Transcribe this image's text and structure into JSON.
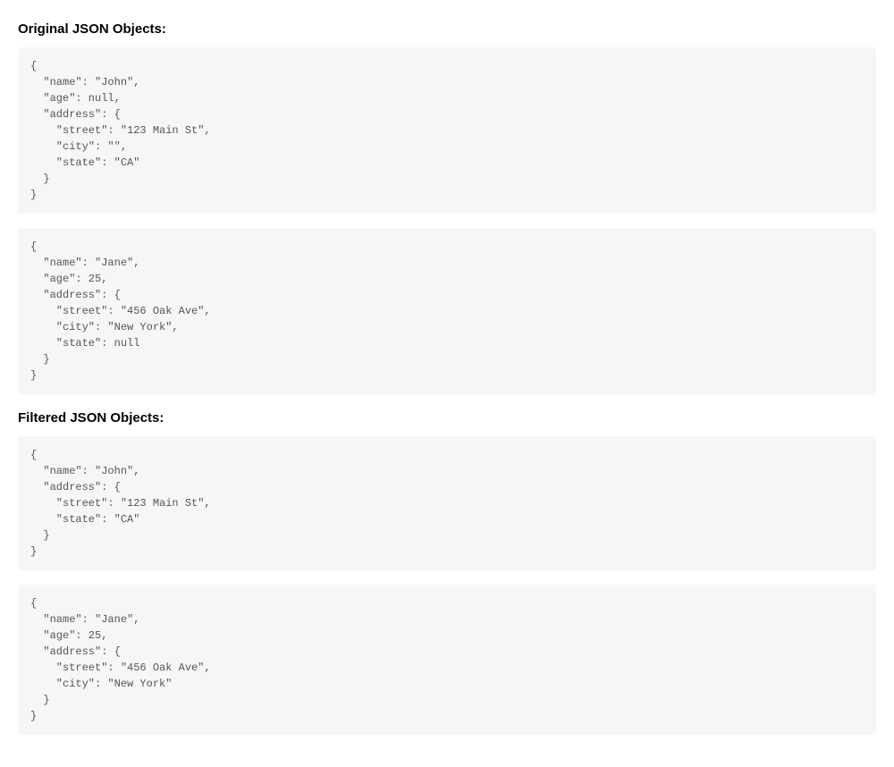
{
  "headings": {
    "original": "Original JSON Objects:",
    "filtered": "Filtered JSON Objects:"
  },
  "codeblocks": {
    "original1": "{\n  \"name\": \"John\",\n  \"age\": null,\n  \"address\": {\n    \"street\": \"123 Main St\",\n    \"city\": \"\",\n    \"state\": \"CA\"\n  }\n}",
    "original2": "{\n  \"name\": \"Jane\",\n  \"age\": 25,\n  \"address\": {\n    \"street\": \"456 Oak Ave\",\n    \"city\": \"New York\",\n    \"state\": null\n  }\n}",
    "filtered1": "{\n  \"name\": \"John\",\n  \"address\": {\n    \"street\": \"123 Main St\",\n    \"state\": \"CA\"\n  }\n}",
    "filtered2": "{\n  \"name\": \"Jane\",\n  \"age\": 25,\n  \"address\": {\n    \"street\": \"456 Oak Ave\",\n    \"city\": \"New York\"\n  }\n}"
  }
}
